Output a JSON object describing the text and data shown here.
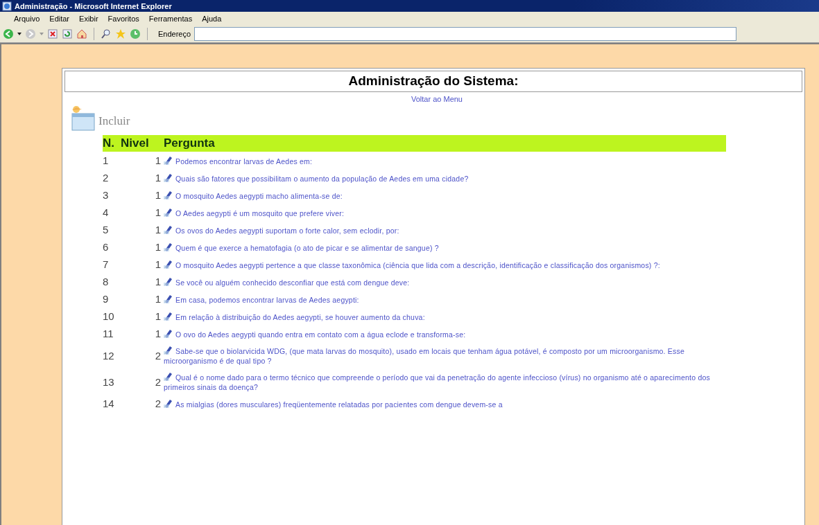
{
  "window": {
    "title": "Administração - Microsoft Internet Explorer"
  },
  "menu": [
    "Arquivo",
    "Editar",
    "Exibir",
    "Favoritos",
    "Ferramentas",
    "Ajuda"
  ],
  "address_bar": {
    "label": "Endereço"
  },
  "page": {
    "heading": "Administração do Sistema:",
    "back_link": "Voltar ao Menu",
    "add_link": "Incluir",
    "table": {
      "columns": [
        "N.",
        "Nivel",
        "Pergunta"
      ],
      "rows": [
        {
          "number": "1",
          "nivel": "1",
          "question": "Podemos encontrar larvas de Aedes em:"
        },
        {
          "number": "2",
          "nivel": "1",
          "question": "Quais são fatores que possibilitam o aumento da população de Aedes em uma cidade?"
        },
        {
          "number": "3",
          "nivel": "1",
          "question": "O mosquito Aedes aegypti macho alimenta-se de:"
        },
        {
          "number": "4",
          "nivel": "1",
          "question": "O Aedes aegypti é um mosquito que prefere viver:"
        },
        {
          "number": "5",
          "nivel": "1",
          "question": "Os ovos do Aedes aegypti suportam o forte calor, sem eclodir, por:"
        },
        {
          "number": "6",
          "nivel": "1",
          "question": "Quem é que exerce a hematofagia (o ato de picar e se alimentar de sangue) ?"
        },
        {
          "number": "7",
          "nivel": "1",
          "question": "O mosquito Aedes aegypti pertence a que classe taxonômica (ciência que lida com a descrição, identificação e classificação dos organismos) ?:"
        },
        {
          "number": "8",
          "nivel": "1",
          "question": "Se você ou alguém conhecido desconfiar que está com dengue deve:"
        },
        {
          "number": "9",
          "nivel": "1",
          "question": "Em casa, podemos encontrar larvas de Aedes aegypti:"
        },
        {
          "number": "10",
          "nivel": "1",
          "question": "Em relação à distribuição do Aedes aegypti, se houver aumento da chuva:"
        },
        {
          "number": "11",
          "nivel": "1",
          "question": "O ovo do Aedes aegypti quando entra em contato com a água eclode e transforma-se:"
        },
        {
          "number": "12",
          "nivel": "2",
          "question": "Sabe-se que o biolarvicida WDG, (que mata larvas do mosquito), usado em locais que tenham água potável, é composto por um microorganismo. Esse microorganismo é de qual tipo ?"
        },
        {
          "number": "13",
          "nivel": "2",
          "question": "Qual é o nome dado para o termo técnico que compreende o período que vai da penetração do agente infeccioso (vírus) no organismo até o aparecimento dos primeiros sinais da doença?"
        },
        {
          "number": "14",
          "nivel": "2",
          "question": "As mialgias (dores musculares) freqüentemente relatadas por pacientes com dengue devem-se a"
        }
      ]
    }
  }
}
